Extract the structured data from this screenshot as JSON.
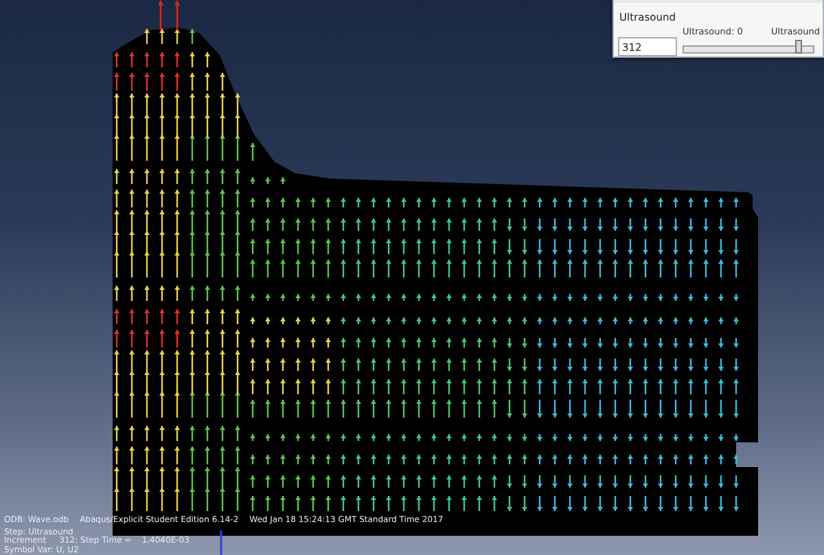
{
  "dialog": {
    "section_label": "Ultrasound",
    "frame_value": "312",
    "slider": {
      "start_label": "Ultrasound: 0",
      "end_label": "Ultrasound",
      "level": 0.86
    }
  },
  "info": {
    "odb": "ODB: Wave.odb",
    "product": "Abaqus/Explicit Student Edition 6.14-2",
    "date": "Wed Jan 18 15:24:13 GMT Standard Time 2017",
    "step": "Step: Ultrasound",
    "increment": "Increment     312: Step Time =    1.4040E-03",
    "symbol": "Symbol Var: U, U2"
  }
}
